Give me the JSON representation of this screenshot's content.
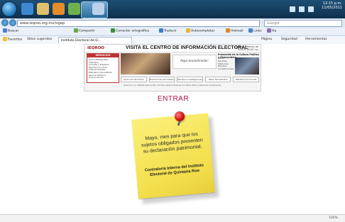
{
  "taskbar": {
    "clock_time": "12:15 p.m.",
    "clock_date": "11/05/2011"
  },
  "browser": {
    "address": "www.ieqroo.org.mx/sigep",
    "search_placeholder": "Google",
    "toolbar": {
      "search_label": "Buscar",
      "share_label": "Compartir",
      "spell_label": "Corrector ortográfico",
      "translate_label": "Traducir",
      "autofill_label": "Autocompletar",
      "mail_label": "Hotmail",
      "links_label": "Links",
      "more_label": "Ha"
    },
    "favorites_label": "Favoritos",
    "suggested_label": "Sitios sugeridos",
    "tab_title": "Instituto Electoral de Q...",
    "page_label": "Página",
    "safety_label": "Seguridad",
    "tools_label": "Herramientas"
  },
  "banner": {
    "logo": "IEQROO",
    "title": "VISITA EL CENTRO DE INFORMACIÓN ELECTORAL",
    "hours": "Lunes a Viernes de 9:00 a 18:00 hrs",
    "services_title": "SERVICIOS",
    "services": [
      "Acervo Bibliográfico",
      "Videoteca",
      "Consulta y Préstamo",
      "Periódico en Línea",
      "Internet Gratuito",
      "Biblioteca Universitaria",
      "Servicio Histórico",
      "Archivo del día"
    ],
    "found_label": "Aquí encontrarás:",
    "protect_title": "Promoción de la Cultura Política y Democrática",
    "protect_items": [
      "Libros",
      "Revistas",
      "Memorias",
      "Estudios",
      "Constituciones"
    ],
    "links": [
      "Centro de Información",
      "Publicaciones del Instituto",
      "Estudios e Investigaciones",
      "Datos, Normatividad",
      "Biblioteca de Consulta"
    ],
    "footer": "Dirección: Av. Calzada Veracruz No. 121 Esq. Lázaro Cárdenas, Col. Barrio Bravo, Chetumal, Quintana Roo"
  },
  "entrar_label": "ENTRAR",
  "note": {
    "message": "Mayo, mes para que los sujetos obligados presenten su declaración patrimonial.",
    "org": "Contraloría Interna del Instituto Electoral de Quintana Roo"
  },
  "status": {
    "zoom": "100%"
  },
  "colors": {
    "accent": "#a8124d",
    "note": "#f3df4c",
    "pin": "#d10f0f"
  }
}
